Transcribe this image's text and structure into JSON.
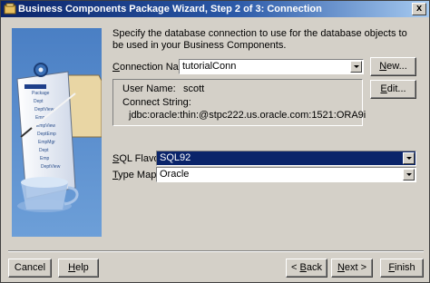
{
  "window": {
    "title": "Business Components Package Wizard, Step 2 of 3: Connection",
    "close_label": "x"
  },
  "instructions": "Specify the database connection to use for the database objects to be used in your Business Components.",
  "connection": {
    "label_prefix": "",
    "label_mnemonic": "C",
    "label_rest": "onnection Name:",
    "value": "tutorialConn",
    "new_button_mnemonic": "N",
    "new_button_rest": "ew..."
  },
  "details": {
    "user_name_label": "User Name:",
    "user_name_value": "scott",
    "connect_string_label": "Connect String:",
    "connect_string_value": "jdbc:oracle:thin:@stpc222.us.oracle.com:1521:ORA9i",
    "edit_button_mnemonic": "E",
    "edit_button_rest": "dit..."
  },
  "sql_flavor": {
    "label_mnemonic": "S",
    "label_rest": "QL Flavor:",
    "value": "SQL92"
  },
  "type_map": {
    "label_mnemonic": "T",
    "label_rest": "ype Map:",
    "value": "Oracle"
  },
  "footer": {
    "cancel_label": "Cancel",
    "help_mnemonic": "H",
    "help_rest": "elp",
    "back_prefix": "< ",
    "back_mnemonic": "B",
    "back_rest": "ack",
    "next_mnemonic": "N",
    "next_rest": "ext >",
    "finish_mnemonic": "F",
    "finish_rest": "inish"
  },
  "illustration": {
    "icon": "wizard-database-illustration",
    "tree_items": [
      "Package",
      "Dept",
      "DeptView",
      "Emp",
      "EmpView",
      "DeptEmp",
      "EmpMgr"
    ]
  }
}
